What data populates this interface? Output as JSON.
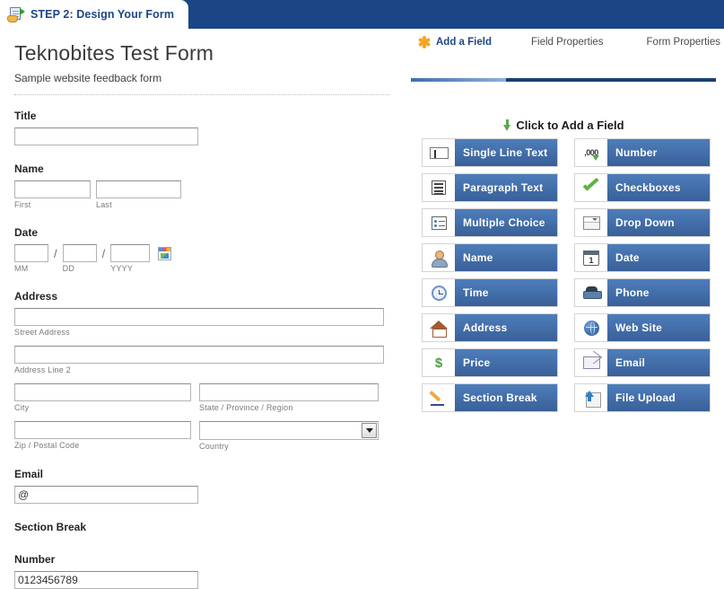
{
  "topbar": {
    "step_tab_label": "STEP 2: Design Your Form",
    "step_tab_icon": "document-with-arrow-icon",
    "background_color": "#1c4586"
  },
  "form": {
    "title": "Teknobites Test Form",
    "subtitle": "Sample website feedback form",
    "fields": [
      {
        "label": "Title",
        "type": "single-line-text",
        "value": ""
      },
      {
        "label": "Name",
        "type": "name",
        "sublabels": [
          "First",
          "Last"
        ]
      },
      {
        "label": "Date",
        "type": "date",
        "sublabels": [
          "MM",
          "DD",
          "YYYY"
        ],
        "separator": "/",
        "calendar_icon": "calendar-picker-icon"
      },
      {
        "label": "Address",
        "type": "address",
        "sublabels": [
          "Street Address",
          "Address Line 2",
          "City",
          "State / Province / Region",
          "Zip / Postal Code",
          "Country"
        ]
      },
      {
        "label": "Email",
        "type": "email",
        "value": "@"
      },
      {
        "label": "Section Break",
        "type": "section-break"
      },
      {
        "label": "Number",
        "type": "number",
        "value": "0123456789"
      }
    ]
  },
  "panel": {
    "tabs": [
      {
        "label": "Add a Field",
        "active": true,
        "icon": "orange-asterisk-icon"
      },
      {
        "label": "Field Properties",
        "active": false
      },
      {
        "label": "Form Properties",
        "active": false
      }
    ],
    "add_header": "Click to Add a Field",
    "add_header_icon": "green-down-arrow-icon",
    "accent_color": "#1c3f73",
    "button_color": "#3a6098",
    "field_buttons": [
      {
        "label": "Single Line Text",
        "icon": "single-line-text-icon"
      },
      {
        "label": "Number",
        "icon": "number-icon"
      },
      {
        "label": "Paragraph Text",
        "icon": "paragraph-text-icon"
      },
      {
        "label": "Checkboxes",
        "icon": "checkmark-icon"
      },
      {
        "label": "Multiple Choice",
        "icon": "multiple-choice-icon"
      },
      {
        "label": "Drop Down",
        "icon": "drop-down-icon"
      },
      {
        "label": "Name",
        "icon": "person-icon"
      },
      {
        "label": "Date",
        "icon": "calendar-icon"
      },
      {
        "label": "Time",
        "icon": "clock-icon"
      },
      {
        "label": "Phone",
        "icon": "phone-icon"
      },
      {
        "label": "Address",
        "icon": "house-icon"
      },
      {
        "label": "Web Site",
        "icon": "globe-icon"
      },
      {
        "label": "Price",
        "icon": "dollar-sign-icon"
      },
      {
        "label": "Email",
        "icon": "envelope-icon"
      },
      {
        "label": "Section Break",
        "icon": "pencil-icon"
      },
      {
        "label": "File Upload",
        "icon": "file-upload-icon"
      }
    ]
  }
}
